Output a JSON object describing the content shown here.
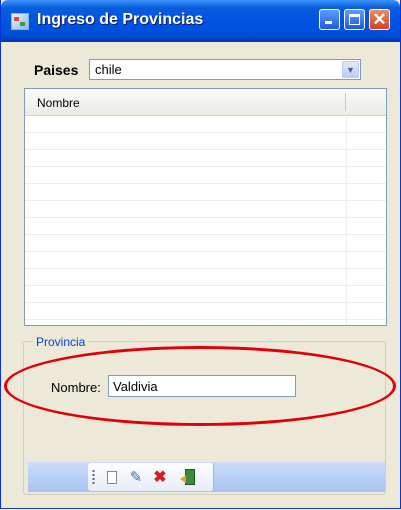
{
  "window": {
    "title": "Ingreso de Provincias"
  },
  "paises": {
    "label": "Paises",
    "selected": "chile"
  },
  "grid": {
    "columns": [
      "Nombre"
    ],
    "rows": []
  },
  "provincia": {
    "group_title": "Provincia",
    "nombre_label": "Nombre:",
    "nombre_value": "Valdivia"
  },
  "toolbar": {
    "icons": [
      "new-document-icon",
      "edit-pencil-icon",
      "delete-x-icon",
      "exit-door-icon"
    ]
  },
  "annotation": {
    "color": "#e0000b"
  }
}
